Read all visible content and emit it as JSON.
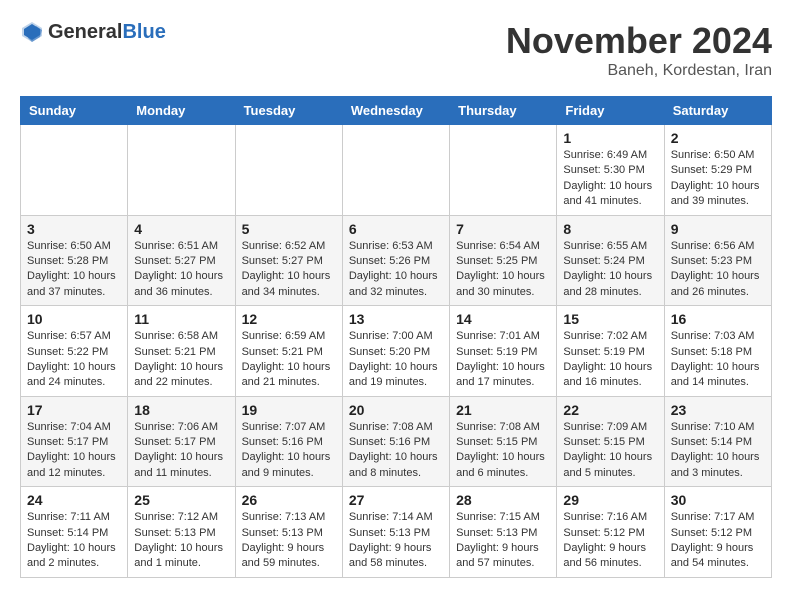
{
  "header": {
    "logo_general": "General",
    "logo_blue": "Blue",
    "month_year": "November 2024",
    "location": "Baneh, Kordestan, Iran"
  },
  "days_of_week": [
    "Sunday",
    "Monday",
    "Tuesday",
    "Wednesday",
    "Thursday",
    "Friday",
    "Saturday"
  ],
  "weeks": [
    [
      {
        "day": "",
        "info": ""
      },
      {
        "day": "",
        "info": ""
      },
      {
        "day": "",
        "info": ""
      },
      {
        "day": "",
        "info": ""
      },
      {
        "day": "",
        "info": ""
      },
      {
        "day": "1",
        "info": "Sunrise: 6:49 AM\nSunset: 5:30 PM\nDaylight: 10 hours and 41 minutes."
      },
      {
        "day": "2",
        "info": "Sunrise: 6:50 AM\nSunset: 5:29 PM\nDaylight: 10 hours and 39 minutes."
      }
    ],
    [
      {
        "day": "3",
        "info": "Sunrise: 6:50 AM\nSunset: 5:28 PM\nDaylight: 10 hours and 37 minutes."
      },
      {
        "day": "4",
        "info": "Sunrise: 6:51 AM\nSunset: 5:27 PM\nDaylight: 10 hours and 36 minutes."
      },
      {
        "day": "5",
        "info": "Sunrise: 6:52 AM\nSunset: 5:27 PM\nDaylight: 10 hours and 34 minutes."
      },
      {
        "day": "6",
        "info": "Sunrise: 6:53 AM\nSunset: 5:26 PM\nDaylight: 10 hours and 32 minutes."
      },
      {
        "day": "7",
        "info": "Sunrise: 6:54 AM\nSunset: 5:25 PM\nDaylight: 10 hours and 30 minutes."
      },
      {
        "day": "8",
        "info": "Sunrise: 6:55 AM\nSunset: 5:24 PM\nDaylight: 10 hours and 28 minutes."
      },
      {
        "day": "9",
        "info": "Sunrise: 6:56 AM\nSunset: 5:23 PM\nDaylight: 10 hours and 26 minutes."
      }
    ],
    [
      {
        "day": "10",
        "info": "Sunrise: 6:57 AM\nSunset: 5:22 PM\nDaylight: 10 hours and 24 minutes."
      },
      {
        "day": "11",
        "info": "Sunrise: 6:58 AM\nSunset: 5:21 PM\nDaylight: 10 hours and 22 minutes."
      },
      {
        "day": "12",
        "info": "Sunrise: 6:59 AM\nSunset: 5:21 PM\nDaylight: 10 hours and 21 minutes."
      },
      {
        "day": "13",
        "info": "Sunrise: 7:00 AM\nSunset: 5:20 PM\nDaylight: 10 hours and 19 minutes."
      },
      {
        "day": "14",
        "info": "Sunrise: 7:01 AM\nSunset: 5:19 PM\nDaylight: 10 hours and 17 minutes."
      },
      {
        "day": "15",
        "info": "Sunrise: 7:02 AM\nSunset: 5:19 PM\nDaylight: 10 hours and 16 minutes."
      },
      {
        "day": "16",
        "info": "Sunrise: 7:03 AM\nSunset: 5:18 PM\nDaylight: 10 hours and 14 minutes."
      }
    ],
    [
      {
        "day": "17",
        "info": "Sunrise: 7:04 AM\nSunset: 5:17 PM\nDaylight: 10 hours and 12 minutes."
      },
      {
        "day": "18",
        "info": "Sunrise: 7:06 AM\nSunset: 5:17 PM\nDaylight: 10 hours and 11 minutes."
      },
      {
        "day": "19",
        "info": "Sunrise: 7:07 AM\nSunset: 5:16 PM\nDaylight: 10 hours and 9 minutes."
      },
      {
        "day": "20",
        "info": "Sunrise: 7:08 AM\nSunset: 5:16 PM\nDaylight: 10 hours and 8 minutes."
      },
      {
        "day": "21",
        "info": "Sunrise: 7:08 AM\nSunset: 5:15 PM\nDaylight: 10 hours and 6 minutes."
      },
      {
        "day": "22",
        "info": "Sunrise: 7:09 AM\nSunset: 5:15 PM\nDaylight: 10 hours and 5 minutes."
      },
      {
        "day": "23",
        "info": "Sunrise: 7:10 AM\nSunset: 5:14 PM\nDaylight: 10 hours and 3 minutes."
      }
    ],
    [
      {
        "day": "24",
        "info": "Sunrise: 7:11 AM\nSunset: 5:14 PM\nDaylight: 10 hours and 2 minutes."
      },
      {
        "day": "25",
        "info": "Sunrise: 7:12 AM\nSunset: 5:13 PM\nDaylight: 10 hours and 1 minute."
      },
      {
        "day": "26",
        "info": "Sunrise: 7:13 AM\nSunset: 5:13 PM\nDaylight: 9 hours and 59 minutes."
      },
      {
        "day": "27",
        "info": "Sunrise: 7:14 AM\nSunset: 5:13 PM\nDaylight: 9 hours and 58 minutes."
      },
      {
        "day": "28",
        "info": "Sunrise: 7:15 AM\nSunset: 5:13 PM\nDaylight: 9 hours and 57 minutes."
      },
      {
        "day": "29",
        "info": "Sunrise: 7:16 AM\nSunset: 5:12 PM\nDaylight: 9 hours and 56 minutes."
      },
      {
        "day": "30",
        "info": "Sunrise: 7:17 AM\nSunset: 5:12 PM\nDaylight: 9 hours and 54 minutes."
      }
    ]
  ]
}
